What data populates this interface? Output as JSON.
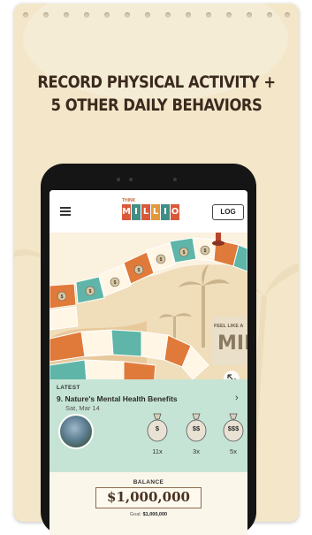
{
  "headline": {
    "line1": "RECORD PHYSICAL ACTIVITY +",
    "line2": "5 OTHER DAILY BEHAVIORS"
  },
  "app": {
    "logo_small_text": "THINK",
    "logo_letters": [
      "M",
      "I",
      "L",
      "L",
      "I",
      "O",
      "N"
    ],
    "log_button": "LOG",
    "board_sign": "FEEL LIKE A",
    "board_sign_letters": "MIL",
    "board_coins": [
      "$",
      "$",
      "$",
      "$",
      "$",
      "$",
      "$"
    ]
  },
  "latest": {
    "label": "LATEST",
    "title": "9. Nature's Mental Health Benefits",
    "date": "Sat, Mar 14",
    "rewards": [
      {
        "amount": "$",
        "count": "11x"
      },
      {
        "amount": "$$",
        "count": "3x"
      },
      {
        "amount": "$$$",
        "count": "5x"
      }
    ]
  },
  "balance": {
    "label": "BALANCE",
    "value": "$1,000,000",
    "goal_label": "Goal:",
    "goal_value": "$1,000,000"
  },
  "colors": {
    "card_bg": "#f3e6c9",
    "board_orange": "#e07a3a",
    "board_teal": "#5fb5a8",
    "latest_bg": "#c6e4d5",
    "logo_red": "#d9593a",
    "logo_teal": "#3f8f86"
  }
}
